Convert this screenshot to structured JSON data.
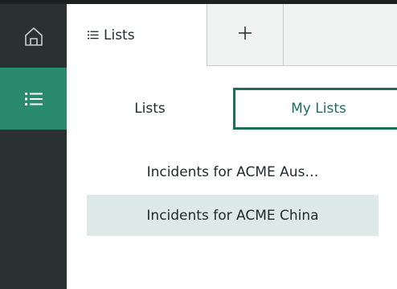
{
  "rail": {
    "home_icon": "home-icon",
    "lists_icon": "list-icon"
  },
  "tabs": {
    "active_label": "Lists",
    "active_icon": "list-icon",
    "add_label": "+"
  },
  "toggle": {
    "left_label": "Lists",
    "right_label": "My Lists",
    "selected": "My Lists"
  },
  "list": {
    "items": [
      {
        "label": "Incidents for ACME Aus…",
        "selected": false
      },
      {
        "label": "Incidents for ACME China",
        "selected": true
      }
    ]
  },
  "colors": {
    "rail_bg": "#2b3130",
    "accent": "#2a8a6e",
    "accent_dark": "#1e6e5a",
    "selected_row": "#dde9e6"
  }
}
